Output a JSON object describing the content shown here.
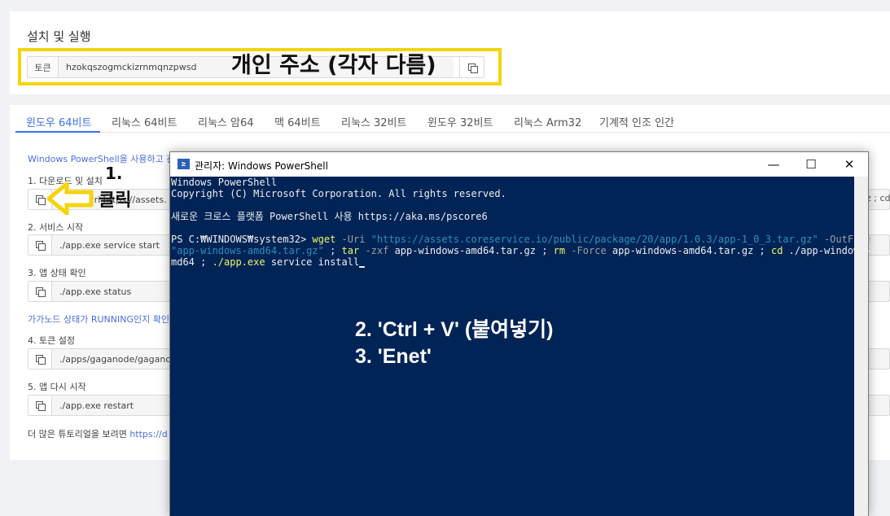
{
  "page": {
    "heading": "설치 및 실행"
  },
  "token": {
    "label": "토큰",
    "value": "hzokqszogmckizrnmqnzpwsd"
  },
  "annotations": {
    "token_note": "개인 주소 (각자 다름)",
    "step1_num": "1.",
    "step1_text": "클릭",
    "step2": "2. 'Ctrl + V' (붙여넣기)",
    "step3": "3. 'Enet'"
  },
  "tabs": [
    {
      "label": "윈도우 64비트",
      "active": true
    },
    {
      "label": "리눅스 64비트"
    },
    {
      "label": "리눅스 암64"
    },
    {
      "label": "맥 64비트"
    },
    {
      "label": "리눅스 32비트"
    },
    {
      "label": "윈도우 32비트"
    },
    {
      "label": "리눅스 Arm32"
    },
    {
      "label": "기계적 인조 인간"
    }
  ],
  "guide": {
    "intro": "Windows PowerShell을 사용하고 관",
    "steps": [
      {
        "label": "1. 다운로드 및 설치",
        "cmd": "wget -Uri https://assets."
      },
      {
        "label": "2. 서비스 시작",
        "cmd": "./app.exe service start"
      },
      {
        "label": "3. 앱 상태 확인",
        "cmd": "./app.exe status"
      },
      {
        "label": "4. 토큰 설정",
        "cmd": "./apps/gaganode/gaganode"
      },
      {
        "label": "5. 앱 다시 시작",
        "cmd": "./app.exe restart"
      }
    ],
    "status_note": "가가노드 상태가 RUNNING인지 확인",
    "more_prefix": "더 많은 튜토리얼을 보려면 ",
    "more_link": "https://d",
    "right_fragment": "gz ; cd"
  },
  "powershell": {
    "title": "관리자: Windows PowerShell",
    "icon_char": "≥",
    "buttons": {
      "minimize": "—",
      "maximize": "☐",
      "close": "✕"
    },
    "line1": "Windows PowerShell",
    "line2": "Copyright (C) Microsoft Corporation. All rights reserved.",
    "line3": "새로운 크로스 플랫폼 PowerShell 사용 https://aka.ms/pscore6",
    "prompt": "PS C:₩WINDOWS₩system32> ",
    "c_wget": "wget",
    "c_uri": " -Uri ",
    "c_url": "\"https://assets.coreservice.io/public/package/20/app/1.0.3/app-1_0_3.tar.gz\"",
    "c_out": " -OutFile",
    "c_file": "\"app-windows-amd64.tar.gz\"",
    "c_sep1": " ; ",
    "c_tar": "tar",
    "c_zxf": " -zxf ",
    "c_targz": "app-windows-amd64.tar.gz",
    "c_sep2": " ; ",
    "c_rm": "rm",
    "c_force": " -Force ",
    "c_rmfile": "app-windows-amd64.tar.gz",
    "c_sep3": " ; ",
    "c_cd": "cd",
    "c_cdpath": " ./app-windows-a",
    "c_md64": "md64 ; ",
    "c_exe": "./app.exe",
    "c_install": " service install"
  }
}
